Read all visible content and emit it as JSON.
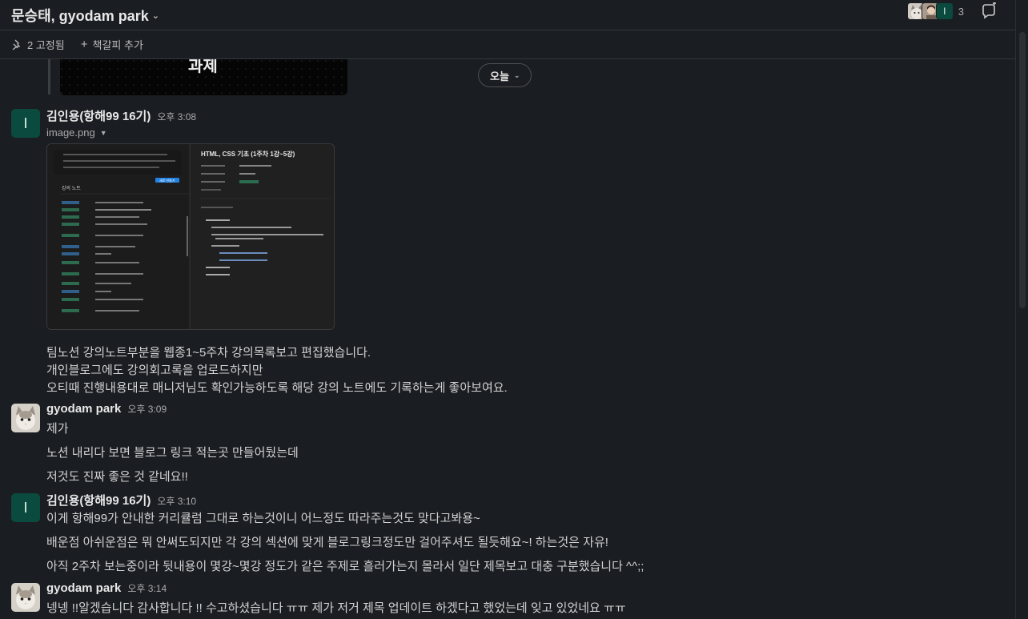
{
  "header": {
    "title": "문승태, gyodam park",
    "member_count": "3",
    "member_initial": "I"
  },
  "subbar": {
    "pinned": "2 고정됨",
    "add_bookmark": "책갈피 추가"
  },
  "previous": {
    "image_text": "과제"
  },
  "day_divider": "오늘",
  "messages": [
    {
      "author": "김인용(항해99 16기)",
      "time": "오후 3:08",
      "initial": "I",
      "file_name": "image.png",
      "thumbnail": {
        "page_title": "HTML, CSS 기초 (1주차 1강~5강)",
        "section_title": "강의 노트",
        "new_button": "새로 만들기"
      },
      "lines": [
        "팀노션 강의노트부분을 웹종1~5주차 강의목록보고 편집했습니다.",
        "개인블로그에도 강의회고록을 업로드하지만",
        "오티때 진행내용대로 매니저님도 확인가능하도록 해당 강의 노트에도 기록하는게 좋아보여요."
      ]
    },
    {
      "author": "gyodam park",
      "time": "오후 3:09",
      "lines": [
        "제가",
        "노션 내리다 보면 블로그 링크 적는곳 만들어뒀는데",
        "저것도 진짜 좋은 것 같네요!!"
      ]
    },
    {
      "author": "김인용(항해99 16기)",
      "time": "오후 3:10",
      "initial": "I",
      "lines": [
        "이게 항해99가 안내한 커리큘럼 그대로 하는것이니 어느정도 따라주는것도 맞다고봐용~",
        "배운점 아쉬운점은 뭐 안써도되지만 각 강의 섹션에 맞게 블로그링크정도만 걸어주셔도 될듯해요~! 하는것은 자유!",
        "아직 2주차 보는중이라 뒷내용이 몇강~몇강 정도가 같은 주제로 흘러가는지 몰라서 일단 제목보고 대충 구분했습니다 ^^;;"
      ]
    },
    {
      "author": "gyodam park",
      "time": "오후 3:14",
      "lines": [
        "넹넹 !!알겠습니다 감사합니다 !! 수고하셨습니다 ㅠㅠ 제가 저거 제목 업데이트 하겠다고 했었는데 잊고 있었네요 ㅠㅠ"
      ]
    }
  ],
  "colors": {
    "background": "#1a1d21",
    "letter_avatar": "#0b4a3e",
    "tag_green": "#2d6b4f",
    "tag_blue": "#2f5f8a",
    "new_button": "#2383e2"
  },
  "icons": {
    "pin": "pin-icon",
    "plus": "plus-icon",
    "huddle": "huddle-icon",
    "chevron": "chevron-down-icon"
  }
}
